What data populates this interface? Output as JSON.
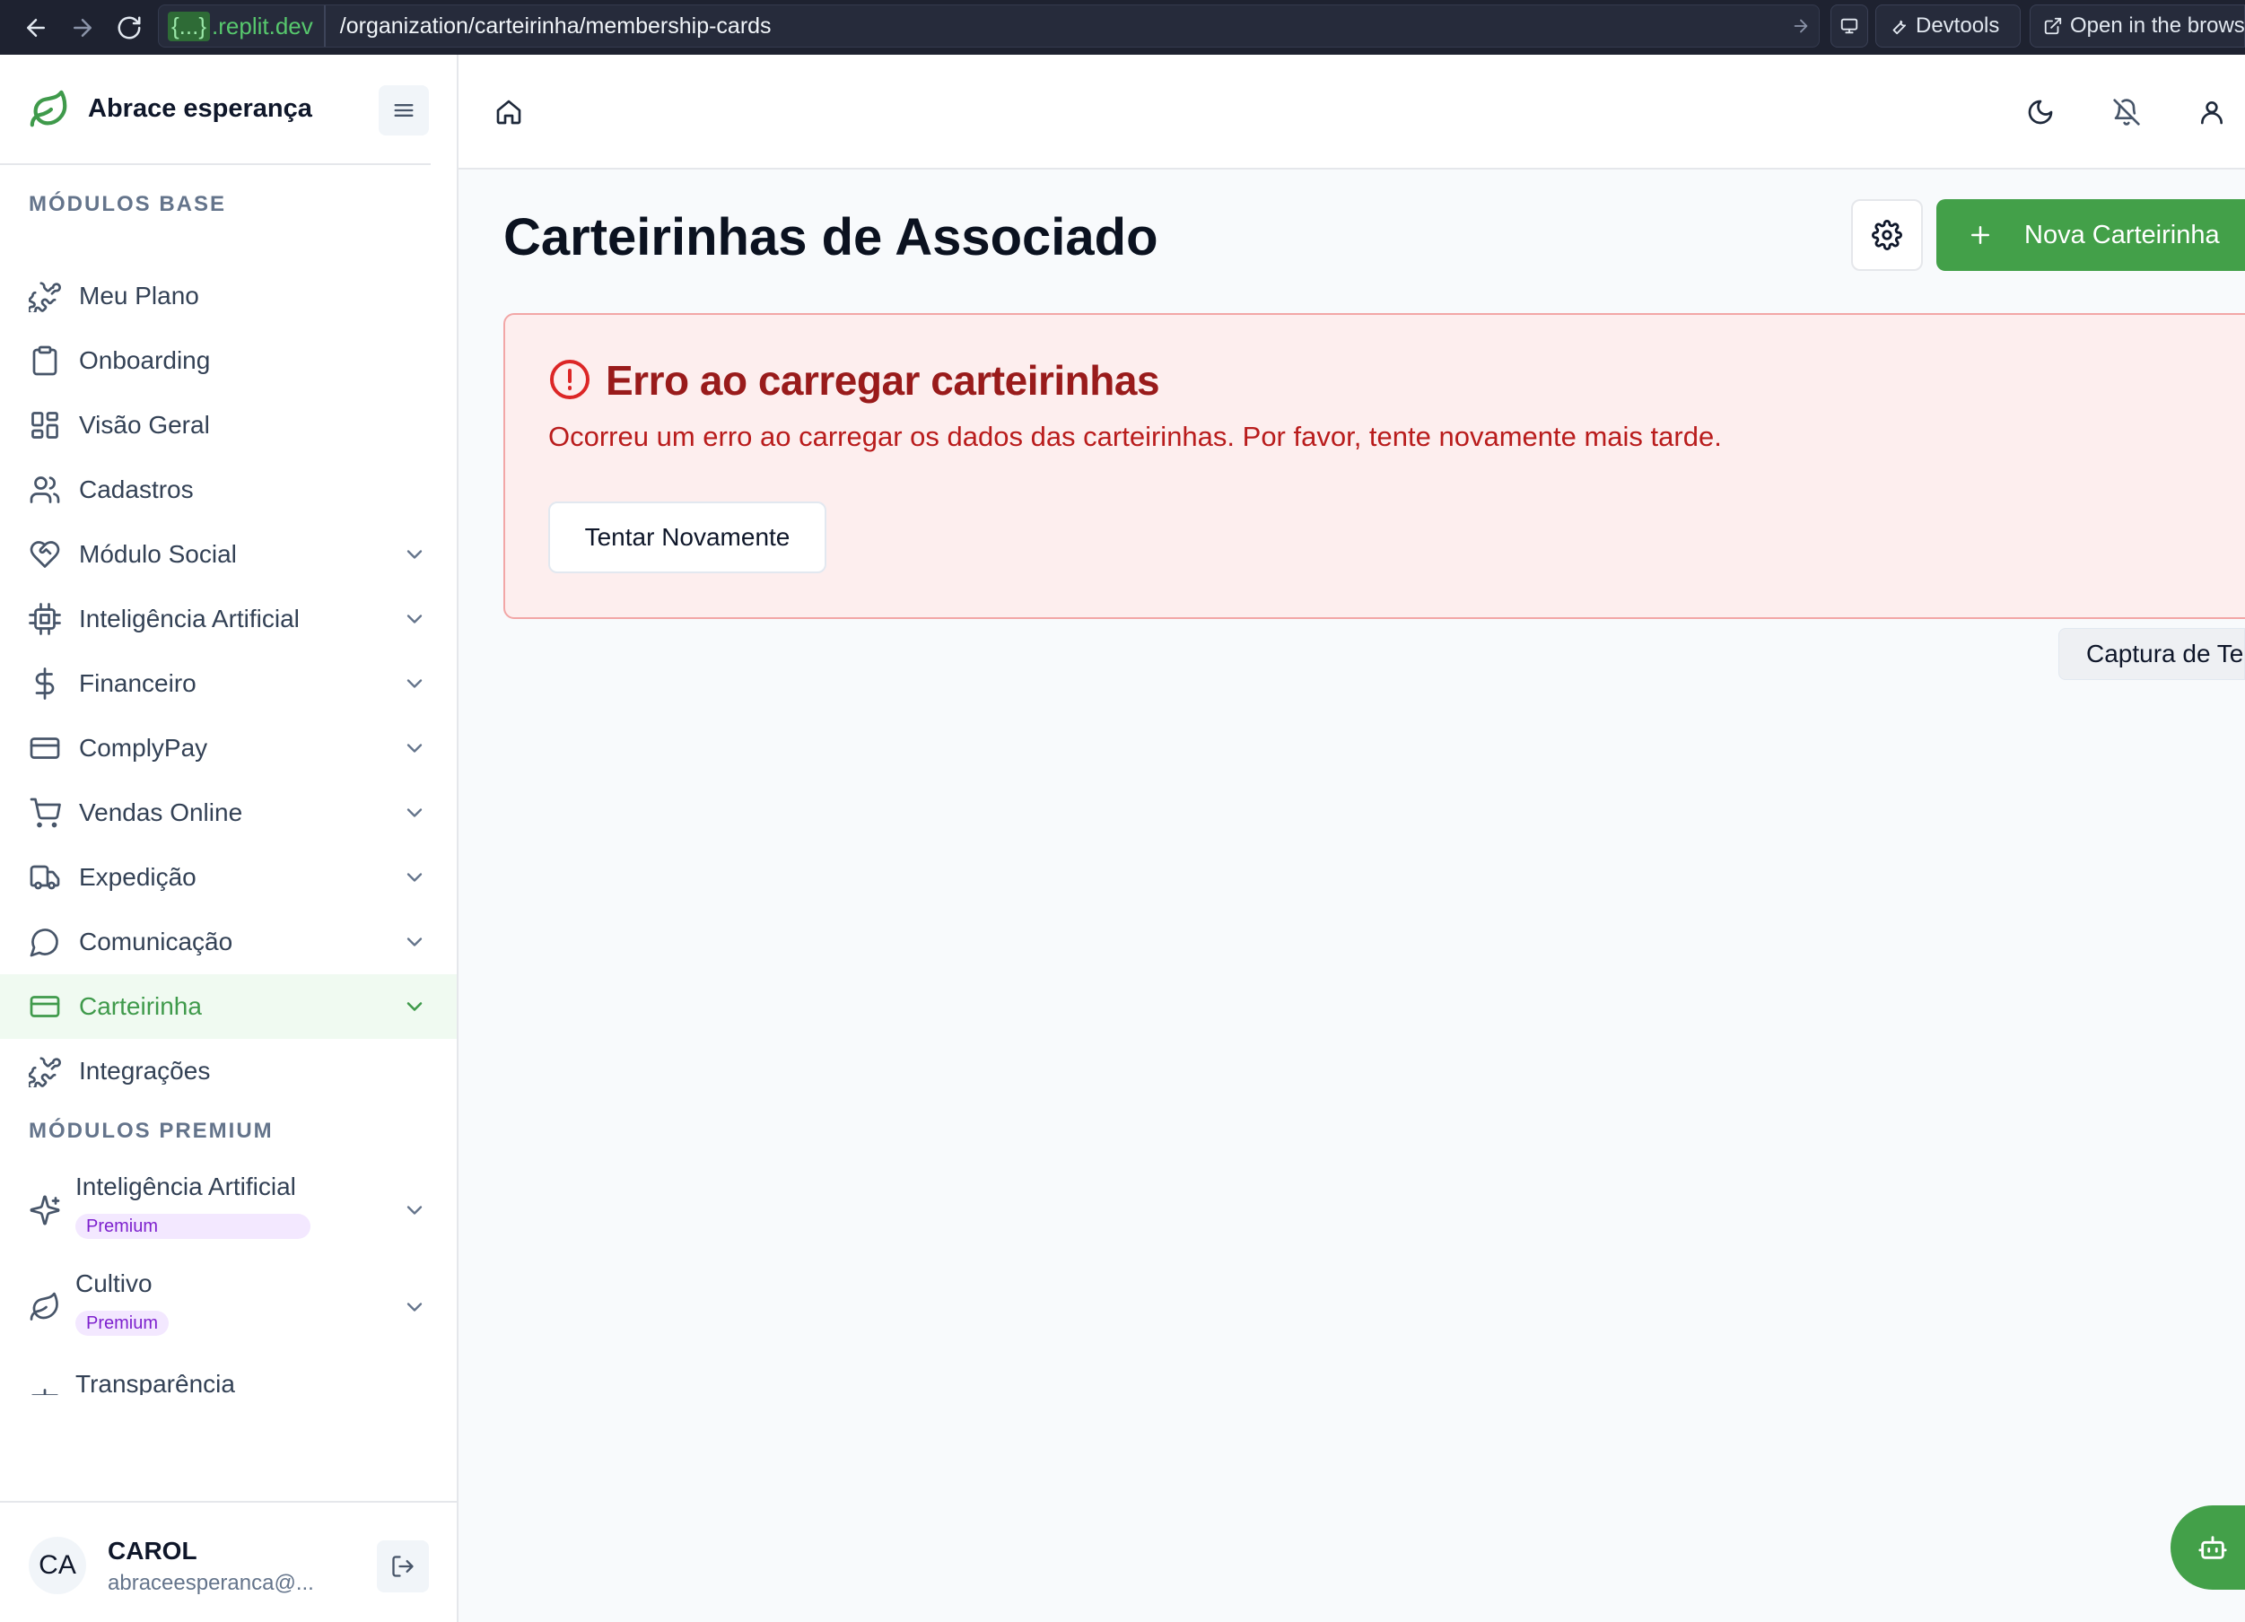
{
  "browser": {
    "domain_braces": "{...}",
    "domain": ".replit.dev",
    "path": "/organization/carteirinha/membership-cards",
    "devtools_label": "Devtools",
    "open_label": "Open in the brows"
  },
  "sidebar": {
    "brand": "Abrace esperança",
    "section_base": "MÓDULOS BASE",
    "items": [
      {
        "label": "Meu Plano",
        "icon": "puzzle-icon",
        "chevron": false
      },
      {
        "label": "Onboarding",
        "icon": "clipboard-icon",
        "chevron": false
      },
      {
        "label": "Visão Geral",
        "icon": "dashboard-icon",
        "chevron": false
      },
      {
        "label": "Cadastros",
        "icon": "users-icon",
        "chevron": false
      },
      {
        "label": "Módulo Social",
        "icon": "heart-handshake-icon",
        "chevron": true
      },
      {
        "label": "Inteligência Artificial",
        "icon": "cpu-icon",
        "chevron": true
      },
      {
        "label": "Financeiro",
        "icon": "dollar-icon",
        "chevron": true
      },
      {
        "label": "ComplyPay",
        "icon": "credit-card-icon",
        "chevron": true
      },
      {
        "label": "Vendas Online",
        "icon": "cart-icon",
        "chevron": true
      },
      {
        "label": "Expedição",
        "icon": "truck-icon",
        "chevron": true
      },
      {
        "label": "Comunicação",
        "icon": "chat-icon",
        "chevron": true
      },
      {
        "label": "Carteirinha",
        "icon": "card-icon",
        "chevron": true,
        "active": true
      },
      {
        "label": "Integrações",
        "icon": "puzzle-icon",
        "chevron": false
      }
    ],
    "section_premium": "MÓDULOS PREMIUM",
    "premium_items": [
      {
        "label": "Inteligência Artificial",
        "badge": "Premium",
        "icon": "sparkles-icon"
      },
      {
        "label": "Cultivo",
        "badge": "Premium",
        "icon": "leaf-icon"
      }
    ],
    "cut_item": "Transparência",
    "user": {
      "initials": "CA",
      "name": "CAROL",
      "email": "abraceesperanca@..."
    }
  },
  "main": {
    "title": "Carteirinhas de Associado",
    "new_button": "Nova Carteirinha",
    "error": {
      "title": "Erro ao carregar carteirinhas",
      "message": "Ocorreu um erro ao carregar os dados das carteirinhas. Por favor, tente novamente mais tarde.",
      "retry": "Tentar Novamente"
    },
    "capture_tab": "Captura de Te"
  },
  "colors": {
    "accent": "#43a049",
    "error_bg": "#fdeeee",
    "error_text": "#991b1b"
  }
}
